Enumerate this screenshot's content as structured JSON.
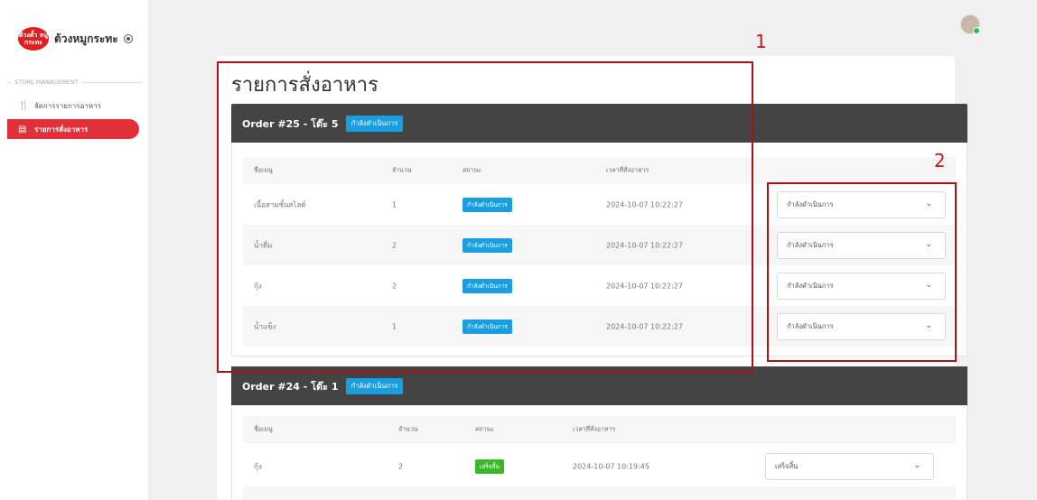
{
  "sidebar": {
    "logo_text": "ต้วงตั้ว หมูกระทะ",
    "brand_name": "ต้วงหมูกระทะ",
    "section_label": "STORE MANAGEMENT",
    "items": [
      {
        "label": "จัดการรายการอาหาร",
        "icon": "utensils-icon",
        "active": false
      },
      {
        "label": "รายการสั่งอาหาร",
        "icon": "receipt-icon",
        "active": true
      }
    ]
  },
  "header": {
    "avatar": "user-avatar"
  },
  "page": {
    "title": "รายการสั่งอาหาร"
  },
  "table_headers": {
    "name": "ชื่อเมนู",
    "qty": "จำนวน",
    "status": "สถานะ",
    "time": "เวลาที่สั่งอาหาร"
  },
  "orders": [
    {
      "title": "Order #25 - โต๊ะ 5",
      "status": "กำลังดำเนินการ",
      "rows": [
        {
          "name": "เนื้อสามชั้นสไลด์",
          "qty": "1",
          "status": "กำลังดำเนินการ",
          "time": "2024-10-07 10:22:27",
          "select": "กำลังดำเนินการ"
        },
        {
          "name": "น้ำดื่ม",
          "qty": "2",
          "status": "กำลังดำเนินการ",
          "time": "2024-10-07 10:22:27",
          "select": "กำลังดำเนินการ"
        },
        {
          "name": "กุ้ง",
          "qty": "2",
          "status": "กำลังดำเนินการ",
          "time": "2024-10-07 10:22:27",
          "select": "กำลังดำเนินการ"
        },
        {
          "name": "น้ำแข็ง",
          "qty": "1",
          "status": "กำลังดำเนินการ",
          "time": "2024-10-07 10:22:27",
          "select": "กำลังดำเนินการ"
        }
      ]
    },
    {
      "title": "Order #24 - โต๊ะ 1",
      "status": "กำลังดำเนินการ",
      "rows": [
        {
          "name": "กุ้ง",
          "qty": "2",
          "status": "เสร็จสิ้น",
          "time": "2024-10-07 10:19:45",
          "select": "เสร็จสิ้น"
        }
      ]
    }
  ],
  "annotations": {
    "one": "1",
    "two": "2"
  },
  "colors": {
    "accent_red": "#e0313a",
    "status_blue": "#1a9ee0",
    "status_green": "#3bb82a",
    "header_dark": "#444444",
    "annotation_red": "#b01010"
  }
}
